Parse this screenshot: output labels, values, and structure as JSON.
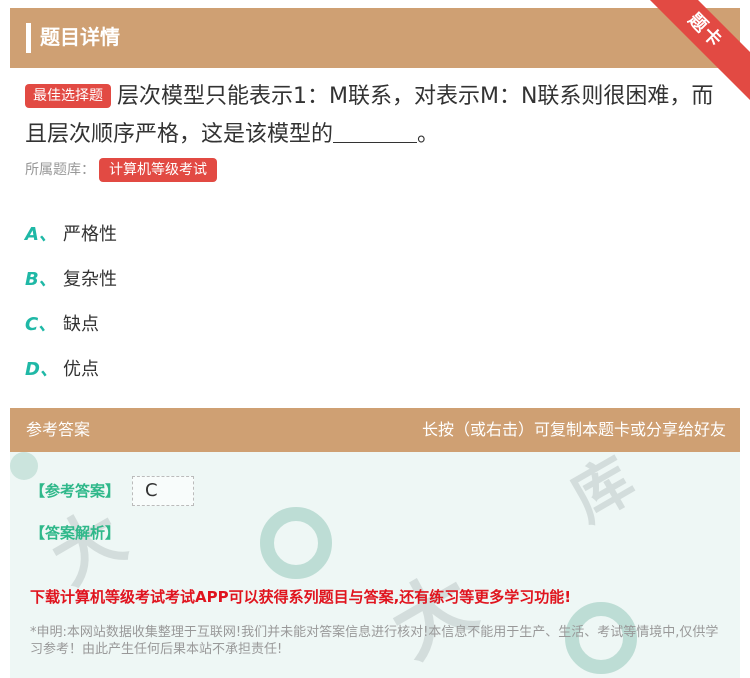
{
  "header": {
    "title": "题目详情",
    "ribbon": "题卡"
  },
  "question": {
    "tag": "最佳选择题",
    "text_before_blank": "层次模型只能表示1：M联系，对表示M：N联系则很困难，而且层次顺序严格，这是该模型的",
    "text_after_blank": "。"
  },
  "source": {
    "label": "所属题库：",
    "library": "计算机等级考试"
  },
  "options": [
    {
      "letter": "A、",
      "text": "严格性"
    },
    {
      "letter": "B、",
      "text": "复杂性"
    },
    {
      "letter": "C、",
      "text": "缺点"
    },
    {
      "letter": "D、",
      "text": "优点"
    }
  ],
  "answer": {
    "header_left": "参考答案",
    "header_right": "长按（或右击）可复制本题卡或分享给好友",
    "ref_label": "【参考答案】",
    "ref_value": "C",
    "analysis_label": "【答案解析】",
    "promo": "下载计算机等级考试考试APP可以获得系列题目与答案,还有练习等更多学习功能!",
    "disclaimer": "*申明:本网站数据收集整理于互联网!我们并未能对答案信息进行核对!本信息不能用于生产、生活、考试等情境中,仅供学习参考！由此产生任何后果本站不承担责任!"
  },
  "colors": {
    "header_bg": "#cfa073",
    "accent_red": "#e24a43",
    "option_letter": "#1fb8a6",
    "answer_green": "#2fb88a",
    "promo_red": "#e0141e"
  }
}
